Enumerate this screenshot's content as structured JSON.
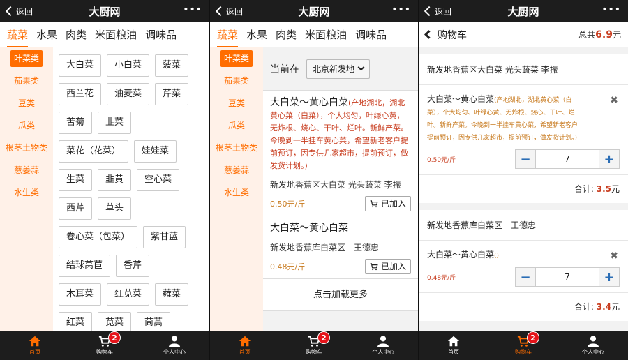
{
  "app_title": "大厨网",
  "back_label": "返回",
  "more_label": "•••",
  "categories": [
    "蔬菜",
    "水果",
    "肉类",
    "米面粮油",
    "调味品"
  ],
  "subcategories": [
    "叶菜类",
    "茄果类",
    "豆类",
    "瓜类",
    "根茎土物类",
    "葱姜蒜",
    "水生类"
  ],
  "tags": [
    "大白菜",
    "小白菜",
    "菠菜",
    "西兰花",
    "油麦菜",
    "芹菜",
    "苦菊",
    "韭菜",
    "菜花（花菜）",
    "娃娃菜",
    "生菜",
    "韭黄",
    "空心菜",
    "西芹",
    "草头",
    "卷心菜（包菜）",
    "紫甘蓝",
    "结球莴苣",
    "香芹",
    "木耳菜",
    "红苋菜",
    "蕹菜",
    "红菜",
    "苋菜",
    "茼蒿"
  ],
  "bottom_tabs": {
    "home": "首页",
    "cart": "购物车",
    "profile": "个人中心",
    "cart_badge": "2"
  },
  "location": {
    "label": "当前在",
    "selected": "北京新发地"
  },
  "products": [
    {
      "name": "大白菜～黄心白菜",
      "desc": "(产地湖北，湖北黄心菜（白菜），个大均匀，叶绿心黄，无炸根、烧心、干叶、烂叶。新鲜产菜。今晚到一半挂车黄心菜，希望新老客户提前预订，因专供几家超市，提前预订，做发货计划。)",
      "vendor": "新发地香蕉区大白菜 光头蔬菜 李振",
      "price": "0.50元/斤",
      "button": "已加入"
    },
    {
      "name": "大白菜～黄心白菜",
      "desc": "",
      "vendor": "新发地香蕉库白菜区　王德忠",
      "price": "0.48元/斤",
      "button": "已加入"
    }
  ],
  "load_more": "点击加载更多",
  "cart": {
    "title": "购物车",
    "total_label": "总共",
    "total_value": "6.9",
    "total_unit": "元",
    "subtotal_label": "合计:",
    "groups": [
      {
        "vendor": "新发地香蕉区大白菜 光头蔬菜 李振",
        "item_name": "大白菜～黄心白菜",
        "item_desc": "(产地湖北，湖北黄心菜（白菜），个大均匀、叶绿心黄、无炸根、烧心、干叶、烂叶。新鲜产菜。今晚到一半挂车黄心菜，希望新老客户提前预订，因专供几家超市，提前预订，做发货计划。)",
        "price": "0.50元/斤",
        "qty": "7",
        "subtotal": "3.5",
        "unit": "元"
      },
      {
        "vendor": "新发地香蕉库白菜区　王德忠",
        "item_name": "大白菜～黄心白菜",
        "item_desc": "()",
        "price": "0.48元/斤",
        "qty": "7",
        "subtotal": "3.4",
        "unit": "元"
      }
    ]
  },
  "colors": {
    "accent": "#ff6d00",
    "topbar": "#1d1d1d",
    "price_red": "#c83c1e",
    "badge": "#e5141a"
  }
}
